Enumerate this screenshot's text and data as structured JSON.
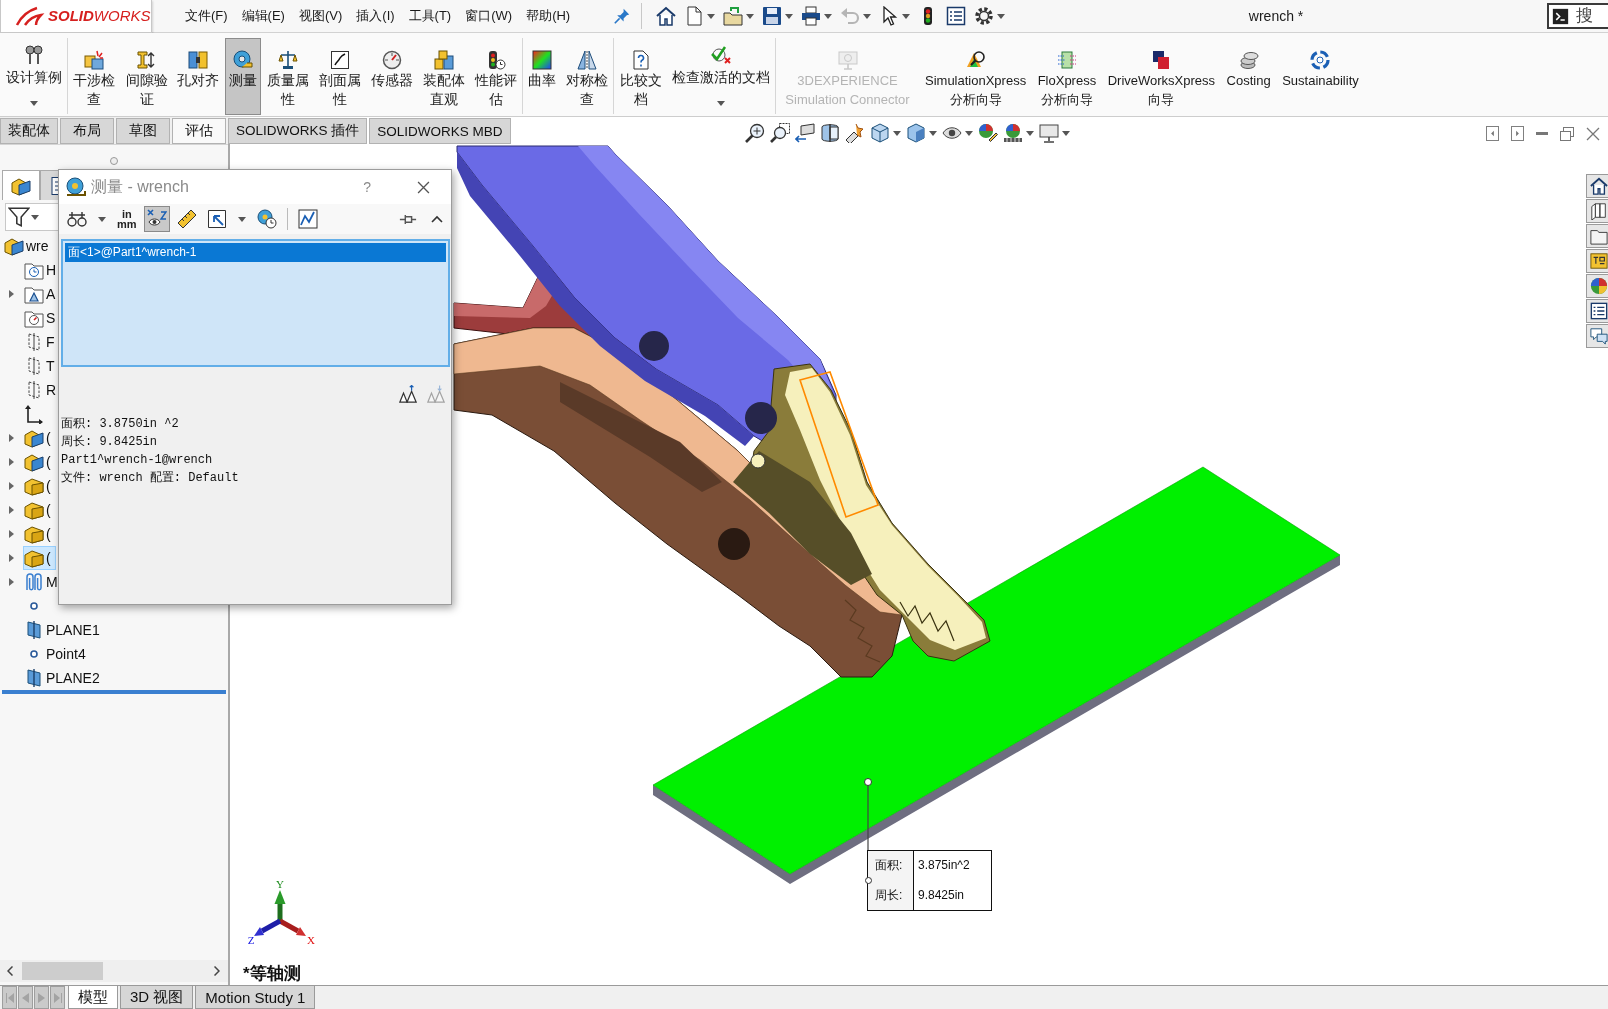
{
  "title_bar": {
    "logo": "**SOLID**WORKS",
    "menu": [
      "文件(F)",
      "编辑(E)",
      "视图(V)",
      "插入(I)",
      "工具(T)",
      "窗口(W)",
      "帮助(H)"
    ],
    "quick_access": [
      {
        "disabled": false,
        "dropdown": false
      },
      {
        "disabled": false,
        "dropdown": true
      },
      {
        "disabled": false,
        "dropdown": true
      },
      {
        "disabled": false,
        "dropdown": true
      },
      {
        "disabled": false,
        "dropdown": true
      },
      {
        "disabled": true,
        "dropdown": true
      },
      {
        "disabled": false,
        "dropdown": true
      },
      {
        "disabled": false,
        "dropdown": false
      },
      {
        "disabled": false,
        "dropdown": false
      },
      {
        "disabled": false,
        "dropdown": true
      }
    ],
    "title": "wrench *",
    "search": {
      "placeholder": "搜"
    }
  },
  "ribbon": {
    "groups": [
      {
        "items": [
          {
            "label": "设计算例",
            "kind": "menu",
            "active": false,
            "disabled": false
          }
        ]
      },
      {
        "items": [
          {
            "label": "干涉检查",
            "kind": "tool",
            "active": false,
            "disabled": false
          },
          {
            "label": "间隙验证",
            "kind": "tool",
            "active": false,
            "disabled": false
          },
          {
            "label": "孔对齐",
            "kind": "tool",
            "active": false,
            "disabled": false
          },
          {
            "label": "测量",
            "kind": "tool",
            "active": true,
            "disabled": false
          },
          {
            "label": "质量属性",
            "kind": "tool",
            "active": false,
            "disabled": false
          },
          {
            "label": "剖面属性",
            "kind": "tool",
            "active": false,
            "disabled": false
          },
          {
            "label": "传感器",
            "kind": "tool",
            "active": false,
            "disabled": false
          },
          {
            "label": "装配体直观",
            "kind": "tool",
            "active": false,
            "disabled": false
          },
          {
            "label": "性能评估",
            "kind": "tool",
            "active": false,
            "disabled": false
          }
        ]
      },
      {
        "items": [
          {
            "label": "曲率",
            "kind": "tool",
            "active": false,
            "disabled": false
          },
          {
            "label": "对称检查",
            "kind": "tool",
            "active": false,
            "disabled": false
          }
        ]
      },
      {
        "items": [
          {
            "label": "比较文档",
            "kind": "tool",
            "active": false,
            "disabled": false
          },
          {
            "label": "检查激活的文档",
            "kind": "menu",
            "active": false,
            "disabled": false
          }
        ]
      },
      {
        "items": [
          {
            "label": "3DEXPERIENCE Simulation Connector",
            "kind": "connector",
            "active": false,
            "disabled": true
          },
          {
            "label": "SimulationXpress 分析向导",
            "kind": "addin",
            "active": false,
            "disabled": false
          },
          {
            "label": "FloXpress 分析向导",
            "kind": "addin",
            "active": false,
            "disabled": false
          },
          {
            "label": "DriveWorksXpress 向导",
            "kind": "addin",
            "active": false,
            "disabled": false
          },
          {
            "label": "Costing",
            "kind": "addin",
            "active": false,
            "disabled": false
          },
          {
            "label": "Sustainability",
            "kind": "addin",
            "active": false,
            "disabled": false
          }
        ]
      }
    ]
  },
  "command_tabs": [
    {
      "label": "装配体",
      "selected": false
    },
    {
      "label": "布局",
      "selected": false
    },
    {
      "label": "草图",
      "selected": false
    },
    {
      "label": "评估",
      "selected": true
    },
    {
      "label": "SOLIDWORKS 插件",
      "selected": false
    },
    {
      "label": "SOLIDWORKS MBD",
      "selected": false
    }
  ],
  "feature_tree": {
    "panel_tabs": [
      {
        "selected": true
      },
      {
        "selected": false
      }
    ],
    "items": [
      {
        "label": "wre",
        "kind": "assembly",
        "selected": false,
        "children": [
          {
            "label": "H",
            "kind": "history",
            "selected": false
          },
          {
            "label": "A",
            "kind": "annotations",
            "selected": false,
            "expanded": false
          },
          {
            "label": "S",
            "kind": "sensors",
            "selected": false
          },
          {
            "label": "F",
            "kind": "plane",
            "selected": false
          },
          {
            "label": "T",
            "kind": "plane",
            "selected": false
          },
          {
            "label": "R",
            "kind": "plane",
            "selected": false
          },
          {
            "kind": "origin",
            "selected": false
          },
          {
            "label": "(",
            "kind": "assembly",
            "selected": false,
            "expanded": false
          },
          {
            "label": "(",
            "kind": "assembly",
            "selected": false,
            "expanded": false
          },
          {
            "label": "(",
            "kind": "part",
            "selected": false,
            "expanded": false
          },
          {
            "label": "(",
            "kind": "part",
            "selected": false,
            "expanded": false
          },
          {
            "label": "(",
            "kind": "part",
            "selected": false,
            "expanded": false
          },
          {
            "label": "(",
            "kind": "part",
            "selected": true,
            "expanded": false
          },
          {
            "label": "M",
            "kind": "mates",
            "selected": false,
            "expanded": false
          },
          {
            "kind": "point",
            "selected": false
          },
          {
            "label": "PLANE1",
            "kind": "solid-plane",
            "selected": false
          },
          {
            "label": "Point4",
            "kind": "point",
            "selected": false
          },
          {
            "label": "PLANE2",
            "kind": "solid-plane",
            "selected": false
          }
        ]
      }
    ]
  },
  "measure_dialog": {
    "title": "测量 - wrench",
    "help": "?",
    "toolbar": [
      {
        "pressed": false,
        "dropdown": true
      },
      {
        "pressed": false,
        "dropdown": false,
        "units": [
          "in",
          "mm"
        ]
      },
      {
        "pressed": true,
        "dropdown": false
      },
      {
        "pressed": false,
        "dropdown": false
      },
      {
        "pressed": false,
        "dropdown": true
      },
      {
        "pressed": false,
        "dropdown": false
      },
      {
        "pressed": false,
        "dropdown": false
      }
    ],
    "selections": [
      {
        "label": "面<1>@Part1^wrench-1",
        "selected": true
      }
    ],
    "text_size": [
      {
        "disabled": false
      },
      {
        "disabled": true
      }
    ],
    "results": [
      "面积: 3.8750in ^2",
      "周长: 9.8425in",
      "Part1^wrench-1@wrench",
      "文件: wrench 配置: Default"
    ]
  },
  "viewport": {
    "callout": [
      {
        "label": "面积:",
        "value": "3.875in^2"
      },
      {
        "label": "周长:",
        "value": "9.8425in"
      }
    ],
    "triad": {
      "x": "X",
      "y": "Y",
      "z": "Z"
    },
    "view_name": "*等轴测"
  },
  "status_tabs": {
    "nav_buttons": [
      {
        "disabled": true
      },
      {
        "disabled": true
      },
      {
        "disabled": true
      },
      {
        "disabled": true
      }
    ],
    "tabs": [
      {
        "label": "模型",
        "selected": true
      },
      {
        "label": "3D 视图",
        "selected": false
      },
      {
        "label": "Motion Study 1",
        "selected": false
      }
    ]
  }
}
